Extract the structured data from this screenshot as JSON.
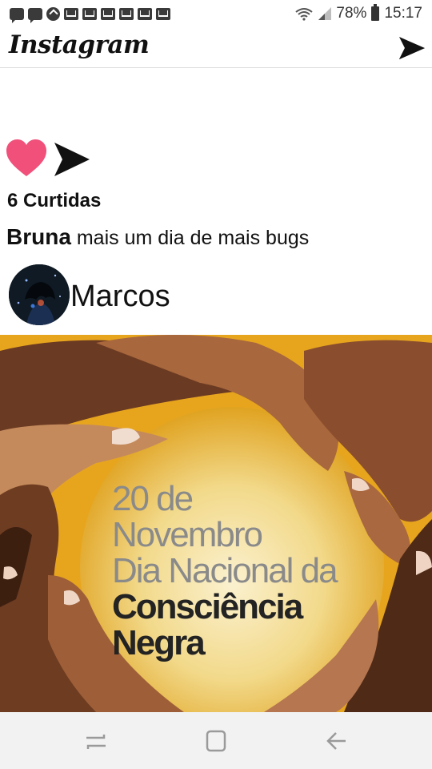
{
  "status_bar": {
    "notification_icons": [
      "chat-icon",
      "chat-icon",
      "app-icon",
      "mail-icon",
      "mail-icon",
      "mail-icon",
      "photo-mail-icon",
      "mail-icon",
      "photo-mail-icon"
    ],
    "battery": "78%",
    "time": "15:17"
  },
  "header": {
    "logo": "Instagram",
    "direct_icon": "send-icon"
  },
  "post": {
    "likes": "6 Curtidas",
    "author": "Bruna",
    "caption": "mais um dia de mais bugs",
    "commenter": "Marcos",
    "image": {
      "line1": "20 de",
      "line2": "Novembro",
      "line3": "Dia Nacional da",
      "line4": "Consciência",
      "line5": "Negra"
    },
    "like_color": "#f0507a"
  },
  "nav": {
    "buttons": [
      "recent-apps-icon",
      "home-icon",
      "back-icon"
    ]
  }
}
